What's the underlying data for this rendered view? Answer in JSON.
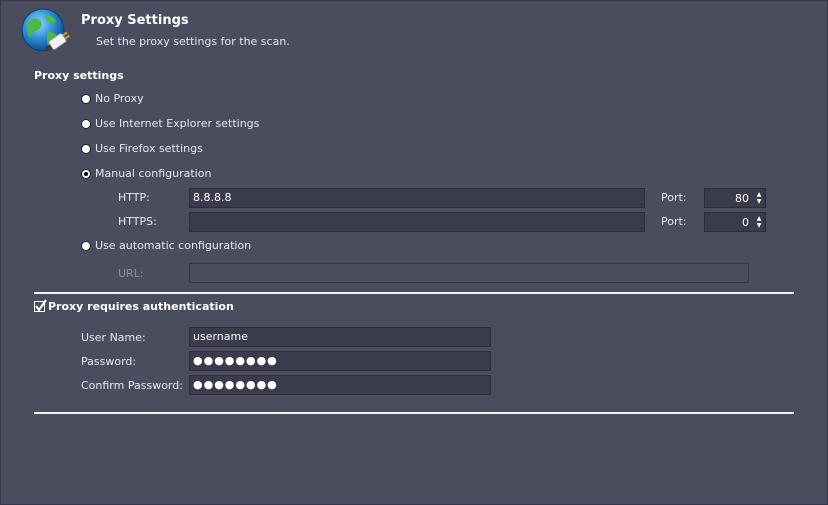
{
  "header": {
    "title": "Proxy Settings",
    "subtitle": "Set the proxy settings for the scan.",
    "icon": "globe-plug-icon"
  },
  "proxy": {
    "section_label": "Proxy settings",
    "options": [
      {
        "label": "No Proxy",
        "checked": false
      },
      {
        "label": "Use Internet Explorer settings",
        "checked": false
      },
      {
        "label": "Use Firefox settings",
        "checked": false
      },
      {
        "label": "Manual configuration",
        "checked": true
      },
      {
        "label": "Use automatic configuration",
        "checked": false
      }
    ],
    "http_label": "HTTP:",
    "http_value": "8.8.8.8",
    "https_label": "HTTPS:",
    "https_value": "",
    "port_label": "Port:",
    "http_port": "80",
    "https_port": "0",
    "url_label": "URL:",
    "url_value": ""
  },
  "auth": {
    "label": "Proxy requires authentication",
    "checked": true,
    "username_label": "User Name:",
    "username_value": "username",
    "password_label": "Password:",
    "password_value": "●●●●●●●●",
    "confirm_label": "Confirm Password:",
    "confirm_value": "●●●●●●●●"
  },
  "colors": {
    "background": "#4a4d5e",
    "field": "#3a3c4b",
    "separator": "#f0f0f0"
  }
}
